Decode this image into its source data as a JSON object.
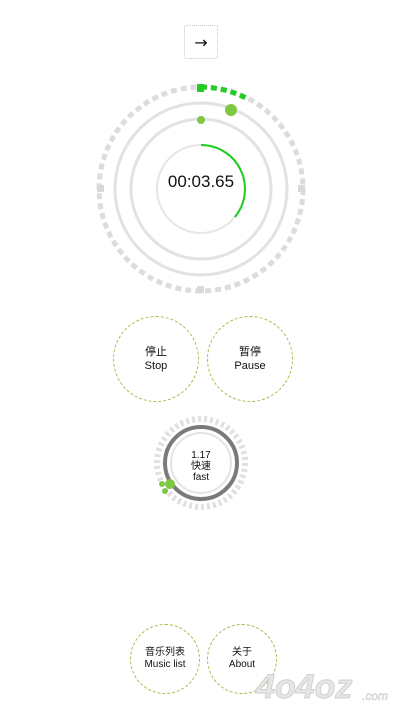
{
  "top": {
    "icon": "right-arrow-icon",
    "glyph": "→"
  },
  "timer": {
    "time": "00:03.65",
    "progress": 0.36,
    "accent_color": "#22cc22",
    "ring_color": "#d9d9d9"
  },
  "controls": {
    "stop": {
      "zh": "停止",
      "en": "Stop"
    },
    "pause": {
      "zh": "暂停",
      "en": "Pause"
    }
  },
  "speed": {
    "value": "1.17",
    "zh": "快速",
    "en": "fast",
    "ring_color": "#7a7a7a",
    "indicator_color": "#7ec845"
  },
  "bottom": {
    "music": {
      "zh": "音乐列表",
      "en": "Music list"
    },
    "about": {
      "zh": "关于",
      "en": "About"
    }
  },
  "watermark": {
    "text": "4o4oz",
    "suffix": ".com"
  }
}
